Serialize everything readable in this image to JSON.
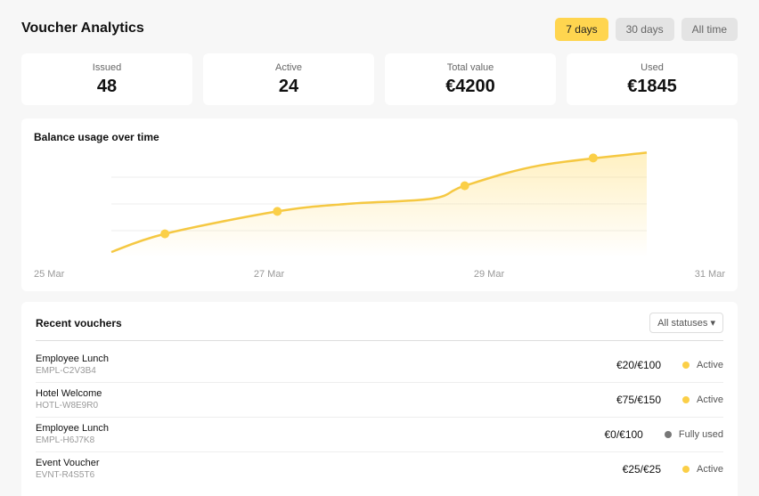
{
  "header": {
    "title": "Voucher Analytics",
    "ranges": [
      "7 days",
      "30 days",
      "All time"
    ],
    "active_range": "7 days"
  },
  "stats": [
    {
      "label": "Issued",
      "value": "48"
    },
    {
      "label": "Active",
      "value": "24"
    },
    {
      "label": "Total value",
      "value": "€4200"
    },
    {
      "label": "Used",
      "value": "€1845"
    }
  ],
  "chart_data": {
    "type": "area",
    "title": "Balance usage over time",
    "x": [
      "25 Mar",
      "27 Mar",
      "29 Mar",
      "31 Mar"
    ],
    "points": [
      {
        "x": 0.5,
        "y": 0.22
      },
      {
        "x": 1.55,
        "y": 0.43
      },
      {
        "x": 3.3,
        "y": 0.67
      },
      {
        "x": 4.5,
        "y": 0.93
      }
    ],
    "line": [
      {
        "x": 0,
        "y": 0.05
      },
      {
        "x": 0.5,
        "y": 0.22
      },
      {
        "x": 1.55,
        "y": 0.43
      },
      {
        "x": 2.2,
        "y": 0.5
      },
      {
        "x": 3.0,
        "y": 0.55
      },
      {
        "x": 3.3,
        "y": 0.67
      },
      {
        "x": 4.0,
        "y": 0.86
      },
      {
        "x": 5.0,
        "y": 0.98
      }
    ],
    "grid": true,
    "colors": {
      "line": "#f5c842",
      "point": "#fbcf47",
      "fill": "#ffd54f"
    }
  },
  "vouchers": {
    "title": "Recent vouchers",
    "filter_label": "All statuses ▾",
    "rows": [
      {
        "name": "Employee Lunch",
        "code": "EMPL-C2V3B4",
        "amount": "€20/€100",
        "status": "Active",
        "dot_color": "#fbcf47"
      },
      {
        "name": "Hotel Welcome",
        "code": "HOTL-W8E9R0",
        "amount": "€75/€150",
        "status": "Active",
        "dot_color": "#fbcf47"
      },
      {
        "name": "Employee Lunch",
        "code": "EMPL-H6J7K8",
        "amount": "€0/€100",
        "status": "Fully used",
        "dot_color": "#777777"
      },
      {
        "name": "Event Voucher",
        "code": "EVNT-R4S5T6",
        "amount": "€25/€25",
        "status": "Active",
        "dot_color": "#fbcf47"
      }
    ]
  }
}
